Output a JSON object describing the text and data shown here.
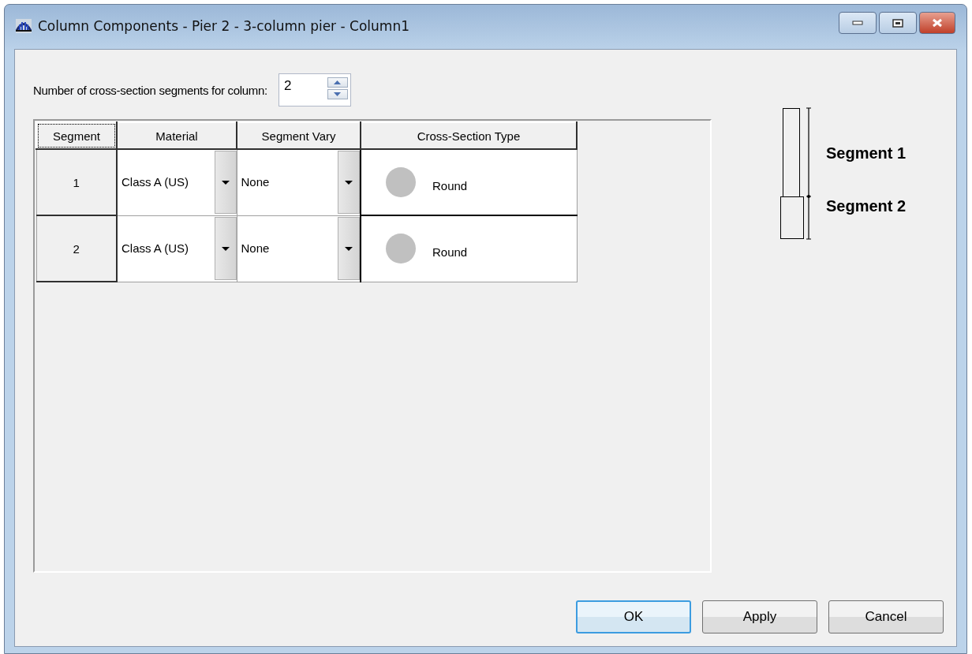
{
  "window": {
    "title": "Column Components - Pier 2 - 3-column pier - Column1"
  },
  "segment_count": {
    "label": "Number of cross-section segments for column:",
    "value": "2"
  },
  "table": {
    "columns": [
      "Segment",
      "Material",
      "Segment Vary",
      "Cross-Section Type"
    ],
    "rows": [
      {
        "segment": "1",
        "material": "Class A (US)",
        "vary": "None",
        "section": "Round"
      },
      {
        "segment": "2",
        "material": "Class A (US)",
        "vary": "None",
        "section": "Round"
      }
    ]
  },
  "diagram": {
    "labels": [
      "Segment 1",
      "Segment 2"
    ]
  },
  "buttons": [
    {
      "label": "OK",
      "focused": true
    },
    {
      "label": "Apply",
      "focused": false
    },
    {
      "label": "Cancel",
      "focused": false
    }
  ]
}
